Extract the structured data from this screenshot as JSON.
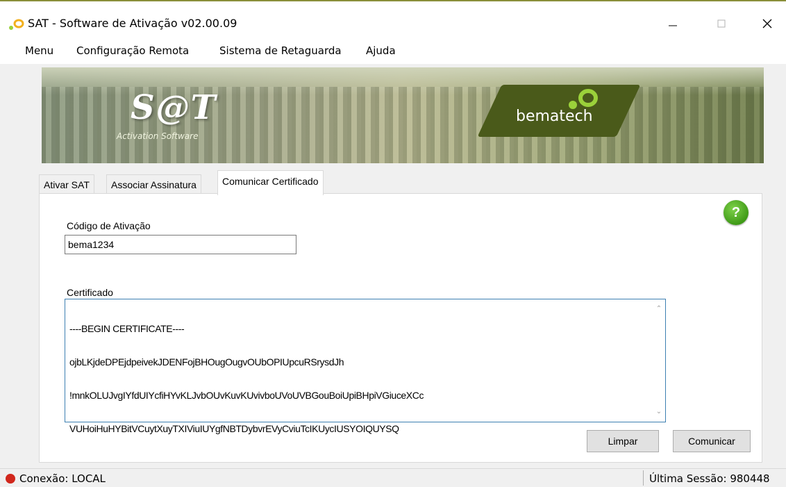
{
  "window": {
    "title": "SAT - Software de Ativação v02.00.09",
    "controls": {
      "minimize_icon": "minimize-icon",
      "maximize_icon": "maximize-icon",
      "close_icon": "close-icon"
    }
  },
  "menu": {
    "items": [
      "Menu",
      "Configuração Remota",
      "Sistema de Retaguarda",
      "Ajuda"
    ]
  },
  "banner": {
    "logo": "S@T",
    "subtitle": "Activation Software",
    "brand": "bematech",
    "colors": {
      "brand_box": "#4a5a1a",
      "accent_green": "#9bd13a"
    }
  },
  "tabs": [
    {
      "label": "Ativar SAT",
      "active": false
    },
    {
      "label": "Associar Assinatura",
      "active": false
    },
    {
      "label": "Comunicar Certificado",
      "active": true
    }
  ],
  "form": {
    "codigo_label": "Código de Ativação",
    "codigo_value": "bema1234",
    "certificado_label": "Certificado",
    "certificado_lines": [
      "----BEGIN CERTIFICATE----",
      "ojbLKjdeDPEjdpeivekJDENFojBHOugOugvOUbOPIUpcuRSrysdJh",
      "!mnkOLUJvgIYfdUIYcfiHYvKLJvbOUvKuvKUvivboUVoUVBGouBoiUpiBHpiVGiuceXCc",
      "VUHoiHuHYBitVCuytXuyTXIViuIUYgfNBTDybvrEVyCviuTcIKUycIUSYOIQUYSQ"
    ],
    "help_icon": "help-icon"
  },
  "buttons": {
    "limpar": "Limpar",
    "comunicar": "Comunicar"
  },
  "status": {
    "connection": "Conexão: LOCAL",
    "last_session": "Última Sessão: 980448",
    "connection_color": "#d1271c"
  }
}
